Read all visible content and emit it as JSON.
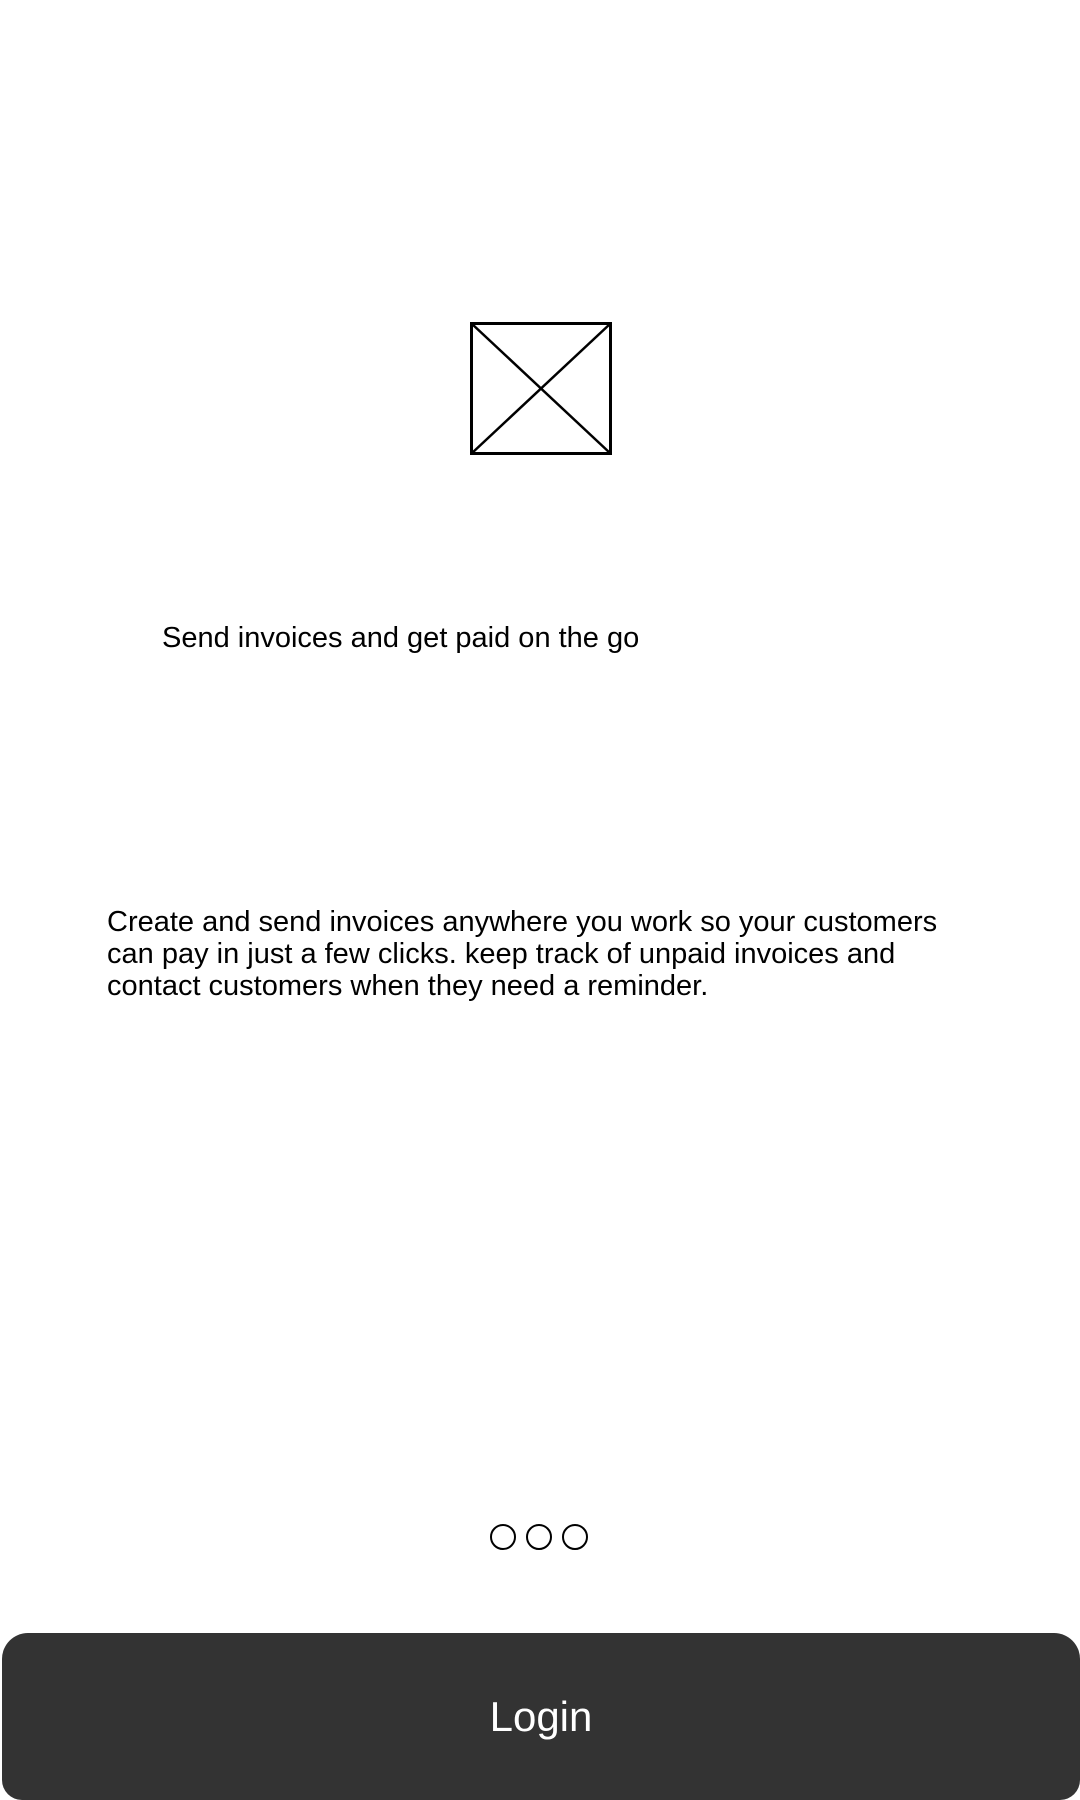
{
  "onboarding": {
    "image_icon": "image-placeholder-icon",
    "headline": "Send invoices and get paid on the go",
    "description": "Create and send invoices anywhere you work so your customers can pay in just a few clicks. keep track of unpaid invoices and contact customers when they need a reminder.",
    "pager": {
      "page_count": 3
    }
  },
  "login_button": {
    "label": "Login",
    "background_color": "#333333",
    "text_color": "#ffffff"
  }
}
